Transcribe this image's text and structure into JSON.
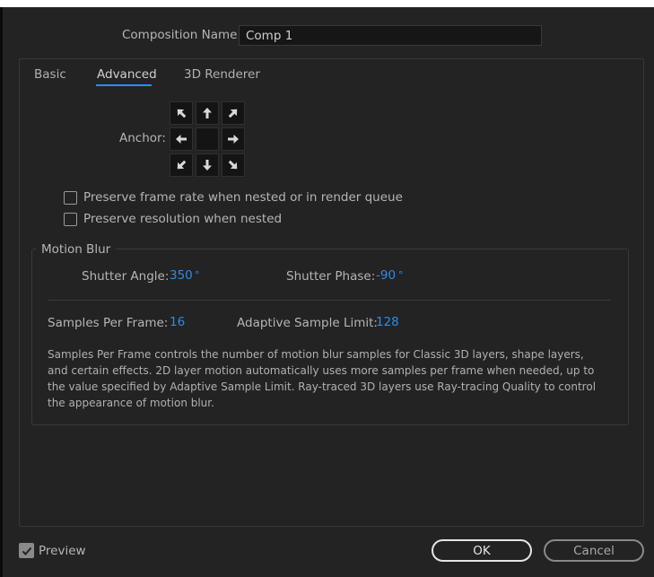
{
  "composition": {
    "name_label": "Composition Name:",
    "name_value": "Comp 1"
  },
  "tabs": [
    {
      "label": "Basic",
      "selected": false
    },
    {
      "label": "Advanced",
      "selected": true
    },
    {
      "label": "3D Renderer",
      "selected": false
    }
  ],
  "anchor": {
    "label": "Anchor:",
    "selected": "center"
  },
  "options": {
    "preserve_frame_rate": {
      "label": "Preserve frame rate when nested or in render queue",
      "checked": false
    },
    "preserve_resolution": {
      "label": "Preserve resolution when nested",
      "checked": false
    }
  },
  "motion_blur": {
    "title": "Motion Blur",
    "shutter_angle": {
      "label": "Shutter Angle:",
      "value": "350",
      "unit": "°"
    },
    "shutter_phase": {
      "label": "Shutter Phase:",
      "value": "-90",
      "unit": "°"
    },
    "samples_per_frame": {
      "label": "Samples Per Frame:",
      "value": "16"
    },
    "adaptive_sample_limit": {
      "label": "Adaptive Sample Limit:",
      "value": "128"
    },
    "description": "Samples Per Frame controls the number of motion blur samples for Classic 3D layers, shape layers, and certain effects. 2D layer motion automatically uses more samples per frame when needed, up to the value specified by Adaptive Sample Limit. Ray-traced 3D layers use Ray-tracing Quality to control the appearance of motion blur."
  },
  "footer": {
    "preview_label": "Preview",
    "preview_checked": true,
    "ok_label": "OK",
    "cancel_label": "Cancel"
  },
  "colors": {
    "accent": "#2d8ceb",
    "background": "#232323"
  }
}
